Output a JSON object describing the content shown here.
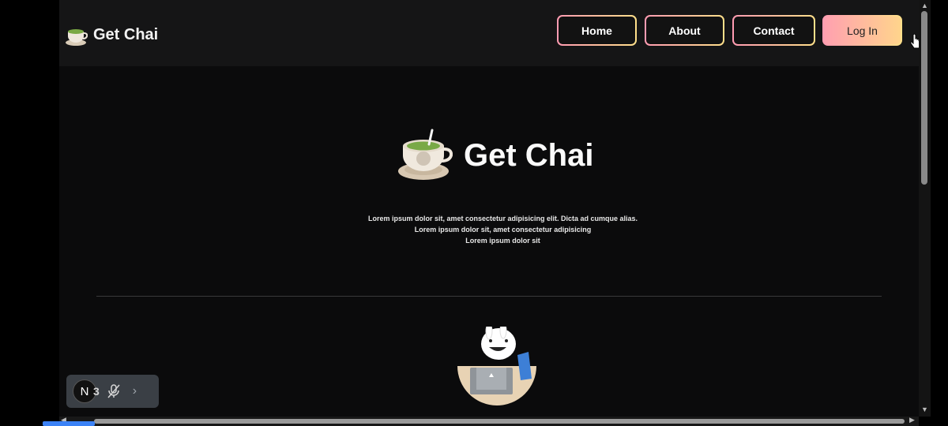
{
  "brand": {
    "name": "Get Chai",
    "icon": "tea-cup-icon"
  },
  "nav": {
    "items": [
      {
        "label": "Home"
      },
      {
        "label": "About"
      },
      {
        "label": "Contact"
      },
      {
        "label": "Log In"
      }
    ]
  },
  "hero": {
    "title": "Get Chai",
    "lines": [
      "Lorem ipsum dolor sit, amet consectetur adipisicing elit. Dicta ad cumque alias.",
      "Lorem ipsum dolor sit, amet consectetur adipisicing",
      "Lorem ipsum dolor sit"
    ]
  },
  "mascot": {
    "icon": "rabbit-with-laptop-icon"
  },
  "toolbar": {
    "avatar_letter": "N",
    "badge": "3"
  },
  "colors": {
    "accent_pink": "#ff9bb2",
    "accent_yellow": "#ffe08a",
    "background": "#0b0b0c"
  }
}
